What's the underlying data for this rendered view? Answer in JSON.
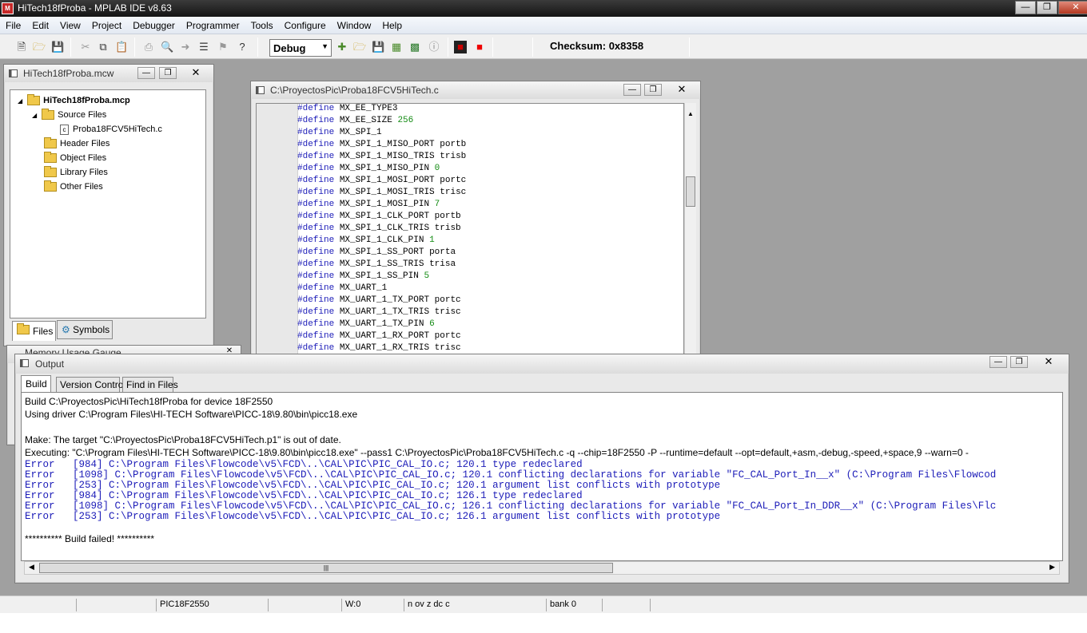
{
  "app": {
    "title": "HiTech18fProba - MPLAB IDE v8.63",
    "icon_text": "MPLAB"
  },
  "menu": [
    "File",
    "Edit",
    "View",
    "Project",
    "Debugger",
    "Programmer",
    "Tools",
    "Configure",
    "Window",
    "Help"
  ],
  "toolbar": {
    "config_value": "Debug",
    "checksum_label": "Checksum:",
    "checksum_value": "0x8358"
  },
  "workspace_window": {
    "title": "HiTech18fProba.mcw",
    "tree": [
      {
        "label": "HiTech18fProba.mcp",
        "level": 0,
        "icon": "folder-icon",
        "bold": true,
        "toggle": "◢"
      },
      {
        "label": "Source Files",
        "level": 1,
        "icon": "folder-icon",
        "toggle": "◢"
      },
      {
        "label": "Proba18FCV5HiTech.c",
        "level": 2,
        "icon": "file-icon"
      },
      {
        "label": "Header Files",
        "level": 1,
        "icon": "folder-icon"
      },
      {
        "label": "Object Files",
        "level": 1,
        "icon": "folder-icon"
      },
      {
        "label": "Library Files",
        "level": 1,
        "icon": "folder-icon"
      },
      {
        "label": "Other Files",
        "level": 1,
        "icon": "folder-icon"
      }
    ],
    "tabs": [
      "Files",
      "Symbols"
    ]
  },
  "memory_gauge": {
    "title": "Memory Usage Gauge"
  },
  "editor": {
    "title": "C:\\ProyectosPic\\Proba18FCV5HiTech.c",
    "lines": [
      {
        "kw": "#define",
        "name": "MX_EE_TYPE3",
        "value": ""
      },
      {
        "kw": "#define",
        "name": "MX_EE_SIZE",
        "value": "256"
      },
      {
        "kw": "#define",
        "name": "MX_SPI_1",
        "value": ""
      },
      {
        "kw": "#define",
        "name": "MX_SPI_1_MISO_PORT",
        "value": "portb"
      },
      {
        "kw": "#define",
        "name": "MX_SPI_1_MISO_TRIS",
        "value": "trisb"
      },
      {
        "kw": "#define",
        "name": "MX_SPI_1_MISO_PIN",
        "value": "0"
      },
      {
        "kw": "#define",
        "name": "MX_SPI_1_MOSI_PORT",
        "value": "portc"
      },
      {
        "kw": "#define",
        "name": "MX_SPI_1_MOSI_TRIS",
        "value": "trisc"
      },
      {
        "kw": "#define",
        "name": "MX_SPI_1_MOSI_PIN",
        "value": "7"
      },
      {
        "kw": "#define",
        "name": "MX_SPI_1_CLK_PORT",
        "value": "portb"
      },
      {
        "kw": "#define",
        "name": "MX_SPI_1_CLK_TRIS",
        "value": "trisb"
      },
      {
        "kw": "#define",
        "name": "MX_SPI_1_CLK_PIN",
        "value": "1"
      },
      {
        "kw": "#define",
        "name": "MX_SPI_1_SS_PORT",
        "value": "porta"
      },
      {
        "kw": "#define",
        "name": "MX_SPI_1_SS_TRIS",
        "value": "trisa"
      },
      {
        "kw": "#define",
        "name": "MX_SPI_1_SS_PIN",
        "value": "5"
      },
      {
        "kw": "#define",
        "name": "MX_UART_1",
        "value": ""
      },
      {
        "kw": "#define",
        "name": "MX_UART_1_TX_PORT",
        "value": "portc"
      },
      {
        "kw": "#define",
        "name": "MX_UART_1_TX_TRIS",
        "value": "trisc"
      },
      {
        "kw": "#define",
        "name": "MX_UART_1_TX_PIN",
        "value": "6"
      },
      {
        "kw": "#define",
        "name": "MX_UART_1_RX_PORT",
        "value": "portc"
      },
      {
        "kw": "#define",
        "name": "MX_UART_1_RX_TRIS",
        "value": "trisc"
      }
    ]
  },
  "output": {
    "title": "Output",
    "tabs": [
      "Build",
      "Version Control",
      "Find in Files"
    ],
    "info_lines": [
      "Build C:\\ProyectosPic\\HiTech18fProba for device 18F2550",
      "Using driver C:\\Program Files\\HI-TECH Software\\PICC-18\\9.80\\bin\\picc18.exe",
      "",
      "Make: The target \"C:\\ProyectosPic\\Proba18FCV5HiTech.p1\" is out of date.",
      "Executing: \"C:\\Program Files\\HI-TECH Software\\PICC-18\\9.80\\bin\\picc18.exe\" --pass1 C:\\ProyectosPic\\Proba18FCV5HiTech.c -q --chip=18F2550 -P --runtime=default --opt=default,+asm,-debug,-speed,+space,9 --warn=0 -"
    ],
    "error_lines": [
      "Error   [984] C:\\Program Files\\Flowcode\\v5\\FCD\\..\\CAL\\PIC\\PIC_CAL_IO.c; 120.1 type redeclared",
      "Error   [1098] C:\\Program Files\\Flowcode\\v5\\FCD\\..\\CAL\\PIC\\PIC_CAL_IO.c; 120.1 conflicting declarations for variable \"FC_CAL_Port_In__x\" (C:\\Program Files\\Flowcod",
      "Error   [253] C:\\Program Files\\Flowcode\\v5\\FCD\\..\\CAL\\PIC\\PIC_CAL_IO.c; 120.1 argument list conflicts with prototype",
      "Error   [984] C:\\Program Files\\Flowcode\\v5\\FCD\\..\\CAL\\PIC\\PIC_CAL_IO.c; 126.1 type redeclared",
      "Error   [1098] C:\\Program Files\\Flowcode\\v5\\FCD\\..\\CAL\\PIC\\PIC_CAL_IO.c; 126.1 conflicting declarations for variable \"FC_CAL_Port_In_DDR__x\" (C:\\Program Files\\Flc",
      "Error   [253] C:\\Program Files\\Flowcode\\v5\\FCD\\..\\CAL\\PIC\\PIC_CAL_IO.c; 126.1 argument list conflicts with prototype"
    ],
    "result": "********** Build failed! **********"
  },
  "status": {
    "device": "PIC18F2550",
    "w": "W:0",
    "flags": "n ov z dc c",
    "bank": "bank 0"
  }
}
